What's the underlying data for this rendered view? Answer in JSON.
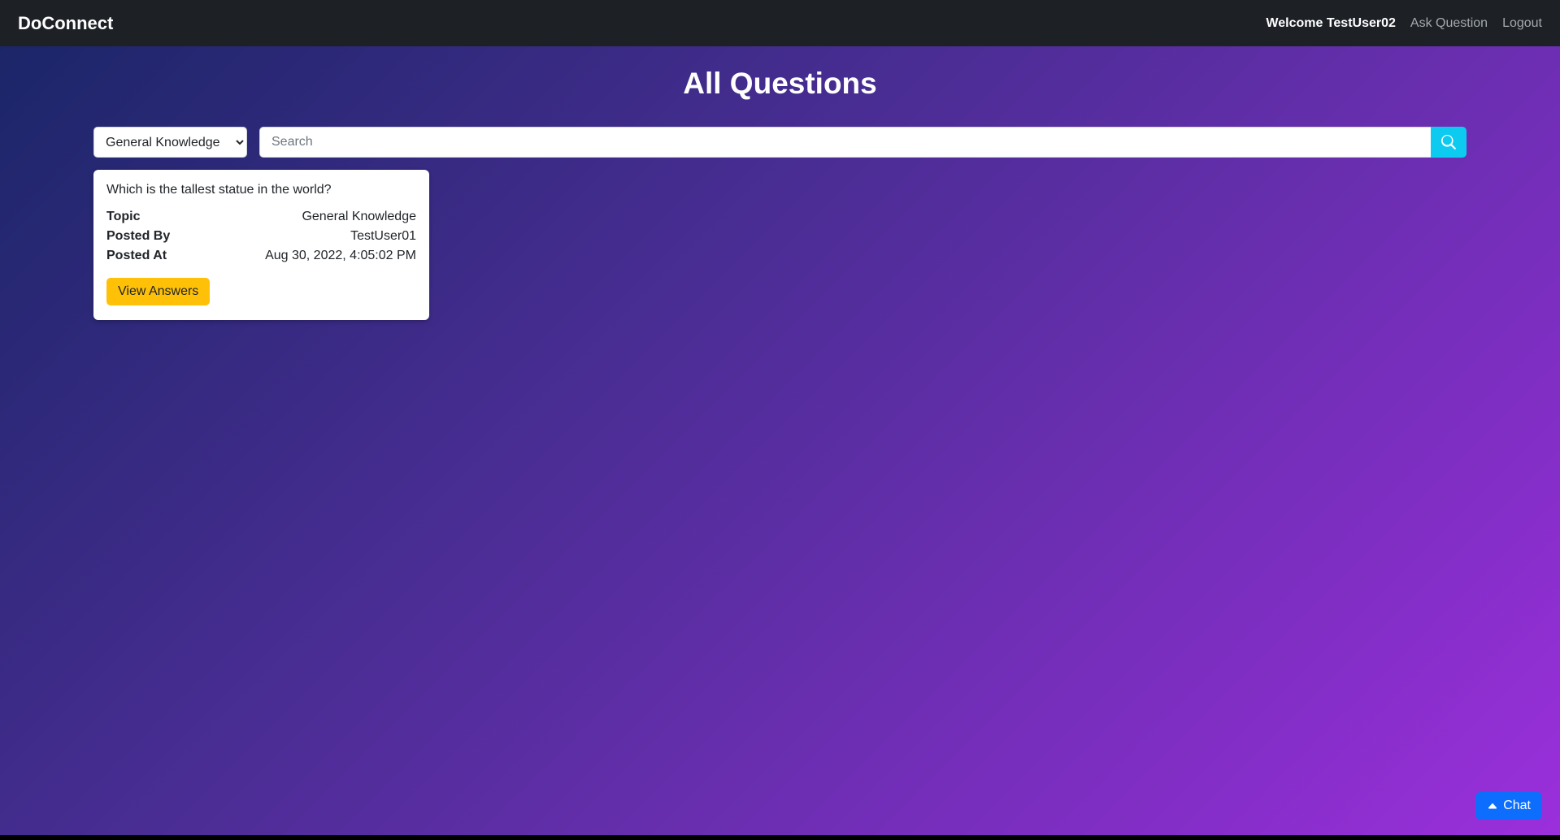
{
  "navbar": {
    "brand": "DoConnect",
    "welcome": "Welcome TestUser02",
    "ask_question": "Ask Question",
    "logout": "Logout"
  },
  "page": {
    "title": "All Questions"
  },
  "filter": {
    "selected_topic": "General Knowledge",
    "search_placeholder": "Search",
    "search_value": ""
  },
  "questions": [
    {
      "title": "Which is the tallest statue in the world?",
      "topic_label": "Topic",
      "topic": "General Knowledge",
      "posted_by_label": "Posted By",
      "posted_by": "TestUser01",
      "posted_at_label": "Posted At",
      "posted_at": "Aug 30, 2022, 4:05:02 PM",
      "view_answers_label": "View Answers"
    }
  ],
  "chat": {
    "label": "Chat"
  }
}
